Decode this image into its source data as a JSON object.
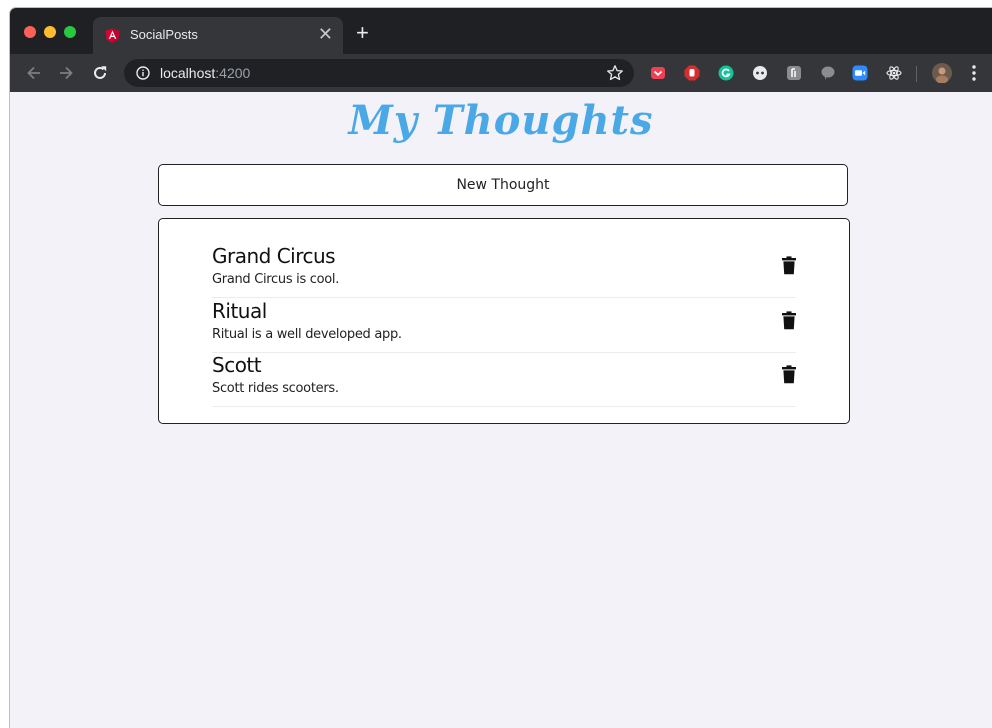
{
  "browser": {
    "tab": {
      "title": "SocialPosts",
      "close_glyph": "✕",
      "favicon": "angular-icon"
    },
    "new_tab_glyph": "+",
    "address": {
      "host": "localhost",
      "port": ":4200"
    },
    "colors": {
      "tab_strip": "#1f2023",
      "toolbar": "#35363a",
      "omnibox": "#202124"
    },
    "extensions": [
      "pocket-icon",
      "adblock-icon",
      "grammarly-icon",
      "extension-icon",
      "reader-icon",
      "chat-bubble-icon",
      "zoom-icon",
      "react-devtools-icon",
      "profile-avatar",
      "more-menu-icon"
    ]
  },
  "page": {
    "heading": "My Thoughts",
    "heading_color": "#4aa8e6",
    "new_thought_label": "New Thought",
    "thoughts": [
      {
        "title": "Grand Circus",
        "body": "Grand Circus is cool."
      },
      {
        "title": "Ritual",
        "body": "Ritual is a well developed app."
      },
      {
        "title": "Scott",
        "body": "Scott rides scooters."
      }
    ]
  }
}
